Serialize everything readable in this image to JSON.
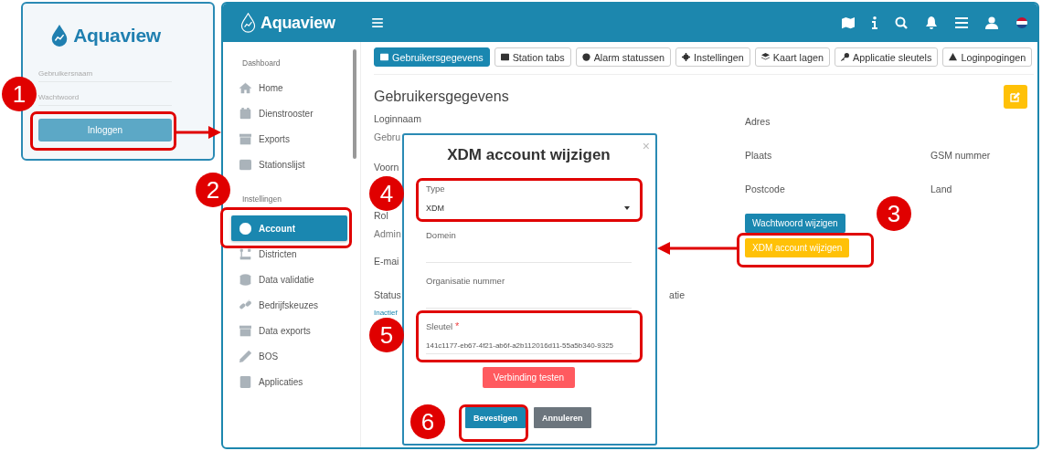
{
  "login_panel": {
    "logo": "Aquaview",
    "username": {
      "placeholder": "Gebruikersnaam"
    },
    "password": {
      "placeholder": "Wachtwoord"
    },
    "login_button": "Inloggen"
  },
  "header": {
    "logo": "Aquaview"
  },
  "sidebar": {
    "sections": [
      {
        "title": "Dashboard",
        "items": [
          {
            "label": "Home",
            "selected": false
          },
          {
            "label": "Dienstrooster",
            "selected": false
          },
          {
            "label": "Exports",
            "selected": false
          },
          {
            "label": "Stationslijst",
            "selected": false
          }
        ]
      },
      {
        "title": "Instellingen",
        "items": [
          {
            "label": "Account",
            "selected": true
          },
          {
            "label": "Districten",
            "selected": false
          },
          {
            "label": "Data validatie",
            "selected": false
          },
          {
            "label": "Bedrijfskeuzes",
            "selected": false
          },
          {
            "label": "Data exports",
            "selected": false
          },
          {
            "label": "BOS",
            "selected": false
          },
          {
            "label": "Applicaties",
            "selected": false
          }
        ]
      }
    ]
  },
  "tabs": [
    {
      "label": "Gebruikersgegevens",
      "selected": true
    },
    {
      "label": "Station tabs",
      "selected": false
    },
    {
      "label": "Alarm statussen",
      "selected": false
    },
    {
      "label": "Instellingen",
      "selected": false
    },
    {
      "label": "Kaart lagen",
      "selected": false
    },
    {
      "label": "Applicatie sleutels",
      "selected": false
    },
    {
      "label": "Loginpogingen",
      "selected": false
    }
  ],
  "details": {
    "title": "Gebruikersgegevens",
    "left": [
      {
        "label": "Loginnaam",
        "value": "Gebru"
      },
      {
        "label": "Voorn"
      },
      {
        "label": "Rol",
        "value": "Admin"
      },
      {
        "label": "E-mai"
      },
      {
        "label": "Status",
        "value": "Inactief"
      }
    ],
    "status_row_fragment": "atie",
    "middle": [
      {
        "label": "Adres"
      },
      {
        "label": "Plaats"
      },
      {
        "label": "Postcode"
      }
    ],
    "right": [
      {
        "label": "GSM nummer"
      },
      {
        "label": "Land"
      }
    ],
    "buttons": [
      {
        "label": "Wachtwoord wijzigen",
        "kind": "primary"
      },
      {
        "label": "XDM account wijzigen",
        "kind": "warning"
      }
    ]
  },
  "modal": {
    "title": "XDM account wijzigen",
    "close": "×",
    "fields": [
      {
        "kind": "select",
        "label": "Type",
        "value": "XDM",
        "required": false
      },
      {
        "kind": "input",
        "label": "Domein",
        "required": false
      },
      {
        "kind": "input",
        "label": "Organisatie nummer",
        "required": false
      },
      {
        "kind": "input",
        "label": "Sleutel",
        "value": "141c1177-eb67-4f21-ab6f-a2b112016d11-55a5b340-9325",
        "required": true
      }
    ],
    "required_mark": "*",
    "test_button": "Verbinding testen",
    "buttons": [
      {
        "label": "Bevestigen",
        "kind": "primary"
      },
      {
        "label": "Annuleren",
        "kind": "secondary"
      }
    ]
  },
  "callouts": [
    "1",
    "2",
    "3",
    "4",
    "5",
    "6"
  ]
}
